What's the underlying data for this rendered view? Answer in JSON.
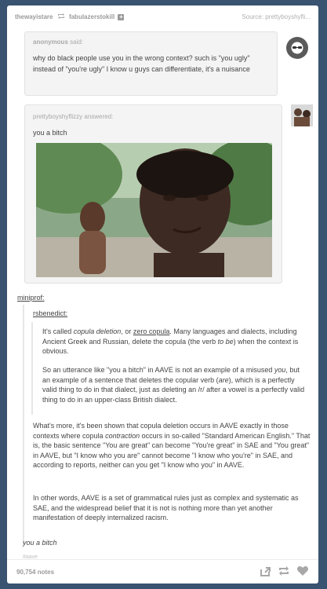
{
  "header": {
    "user_from": "thewayistare",
    "user_to": "fabulazerstokill",
    "source": "Source: prettyboyshyfli..."
  },
  "ask": {
    "asker": "anonymous",
    "asker_suffix": " said:",
    "question": "why do black people use you in the wrong context? such is \"you ugly\" instead of \"you're ugly\" I know u guys can differentiate, it's a nuisance"
  },
  "answer": {
    "answerer": "prettyboyshyflizzy",
    "answerer_suffix": " answered:",
    "text": "you a bitch"
  },
  "reblog": {
    "user1": "miniprof",
    "user1_suffix": ":",
    "user2": "rsbenedict",
    "user2_suffix": ":"
  },
  "quote": {
    "p1_a": "It's called ",
    "p1_b": "copula deletion",
    "p1_c": ", or ",
    "p1_d": "zero copula",
    "p1_e": ". Many languages and dialects, including Ancient Greek and Russian, delete the copula (the verb ",
    "p1_f": "to be",
    "p1_g": ") when the context is obvious.",
    "p2_a": "So an utterance like \"you a bitch\" in AAVE is not an example of a misused ",
    "p2_b": "you",
    "p2_c": ", but an example of a sentence that deletes the copular verb (",
    "p2_d": "are",
    "p2_e": "), which is a perfectly valid thing to do in that dialect, just as deleting an /r/ after a vowel is a perfectly valid thing to do in an upper-class British dialect.",
    "p3_a": "What's more, it's been shown that copula deletion occurs in AAVE exactly in those contexts where copula ",
    "p3_b": "contraction",
    "p3_c": " occurs in so-called \"Standard American English.\" That is, the basic sentence \"You are great\" can become \"You're great\" in SAE and \"You great\" in AAVE, but \"I know who you are\" cannot become \"I know who you're\" in SAE, and according to reports, neither can you get \"I know who you\" in AAVE.",
    "p4": "In other words, AAVE is a set of grammatical rules just as complex and systematic as SAE, and the widespread belief that it is not is nothing more than yet another manifestation of deeply internalized racism."
  },
  "final_line": "you a bitch",
  "tag": "#aave",
  "notes": "90,754 notes",
  "icons": [
    "reblog-icon",
    "plus-icon",
    "ask-avatar-icon",
    "share-icon",
    "reblog-action-icon",
    "like-icon"
  ]
}
